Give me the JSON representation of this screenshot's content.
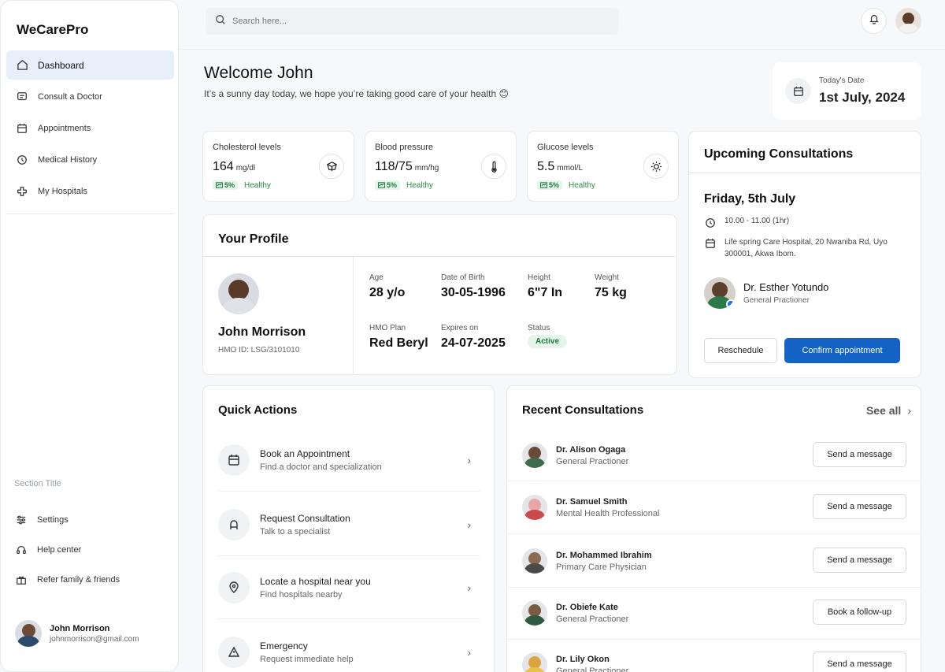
{
  "app": {
    "brand": "WeCarePro"
  },
  "sidebar": {
    "items": [
      {
        "label": "Dashboard",
        "icon": "home-icon",
        "active": true
      },
      {
        "label": "Consult a Doctor",
        "icon": "chat-icon"
      },
      {
        "label": "Appointments",
        "icon": "calendar-icon"
      },
      {
        "label": "Medical History",
        "icon": "history-icon"
      },
      {
        "label": "My Hospitals",
        "icon": "hospital-icon"
      }
    ],
    "section_title": "Section Title",
    "bottom_items": [
      {
        "label": "Settings",
        "icon": "settings-icon"
      },
      {
        "label": "Help center",
        "icon": "headset-icon"
      },
      {
        "label": "Refer family & friends",
        "icon": "gift-icon"
      }
    ],
    "user": {
      "name": "John Morrison",
      "email": "johnmorrison@gmail.com"
    }
  },
  "topbar": {
    "search_placeholder": "Search here..."
  },
  "welcome": {
    "title": "Welcome John",
    "subtitle": "It’s a sunny day today, we hope you’re taking good care of your health 😊"
  },
  "date_card": {
    "label": "Today's Date",
    "value": "1st July, 2024"
  },
  "metrics": [
    {
      "label": "Cholesterol levels",
      "value": "164",
      "unit": "mg/dl",
      "change": "5%",
      "status": "Healthy",
      "icon": "cube-icon"
    },
    {
      "label": "Blood pressure",
      "value": "118/75",
      "unit": "mm/hg",
      "change": "5%",
      "status": "Healthy",
      "icon": "thermometer-icon"
    },
    {
      "label": "Glucose levels",
      "value": "5.5",
      "unit": "mmol/L",
      "change": "5%",
      "status": "Healthy",
      "icon": "sun-icon"
    }
  ],
  "profile": {
    "title": "Your Profile",
    "name": "John Morrison",
    "hmo_id": "HMO ID: LSG/3101010",
    "fields": {
      "age": {
        "label": "Age",
        "value": "28 y/o"
      },
      "dob": {
        "label": "Date of Birth",
        "value": "30-05-1996"
      },
      "height": {
        "label": "Height",
        "value": "6\"7 In"
      },
      "weight": {
        "label": "Weight",
        "value": "75 kg"
      },
      "hmo_plan": {
        "label": "HMO Plan",
        "value": "Red Beryl"
      },
      "expires": {
        "label": "Expires on",
        "value": "24-07-2025"
      },
      "status": {
        "label": "Status",
        "value": "Active"
      }
    }
  },
  "upcoming": {
    "title": "Upcoming Consultations",
    "date": "Friday, 5th July",
    "time": "10.00 - 11.00 (1hr)",
    "location": "Life spring Care Hospital, 20 Nwaniba Rd, Uyo 300001, Akwa Ibom.",
    "doctor": {
      "name": "Dr. Esther Yotundo",
      "role": "General Practioner"
    },
    "reschedule_label": "Reschedule",
    "confirm_label": "Confirm appointment"
  },
  "quick_actions": {
    "title": "Quick Actions",
    "items": [
      {
        "title": "Book an Appointment",
        "subtitle": "Find a doctor and specialization",
        "icon": "calendar-icon"
      },
      {
        "title": "Request Consultation",
        "subtitle": "Talk to a specialist",
        "icon": "lock-icon"
      },
      {
        "title": "Locate a hospital near you",
        "subtitle": "Find hospitals nearby",
        "icon": "location-icon"
      },
      {
        "title": "Emergency",
        "subtitle": "Request immediate help",
        "icon": "alert-icon"
      }
    ]
  },
  "recent": {
    "title": "Recent Consultations",
    "see_all": "See all",
    "message_label": "Send a message",
    "items": [
      {
        "name": "Dr. Alison Ogaga",
        "role": "General Practioner",
        "action": "Send a message"
      },
      {
        "name": "Dr. Samuel Smith",
        "role": "Mental Health Professional",
        "action": "Send a message"
      },
      {
        "name": "Dr. Mohammed Ibrahim",
        "role": "Primary Care Physician",
        "action": "Send a message"
      },
      {
        "name": "Dr. Obiefe Kate",
        "role": "General Practioner",
        "action": "Book a follow-up"
      },
      {
        "name": "Dr. Lily Okon",
        "role": "General Practioner",
        "action": "Send a message"
      }
    ]
  },
  "colors": {
    "accent": "#1463c4",
    "active_bg": "#e7effa",
    "healthy": "#2a8a47"
  }
}
